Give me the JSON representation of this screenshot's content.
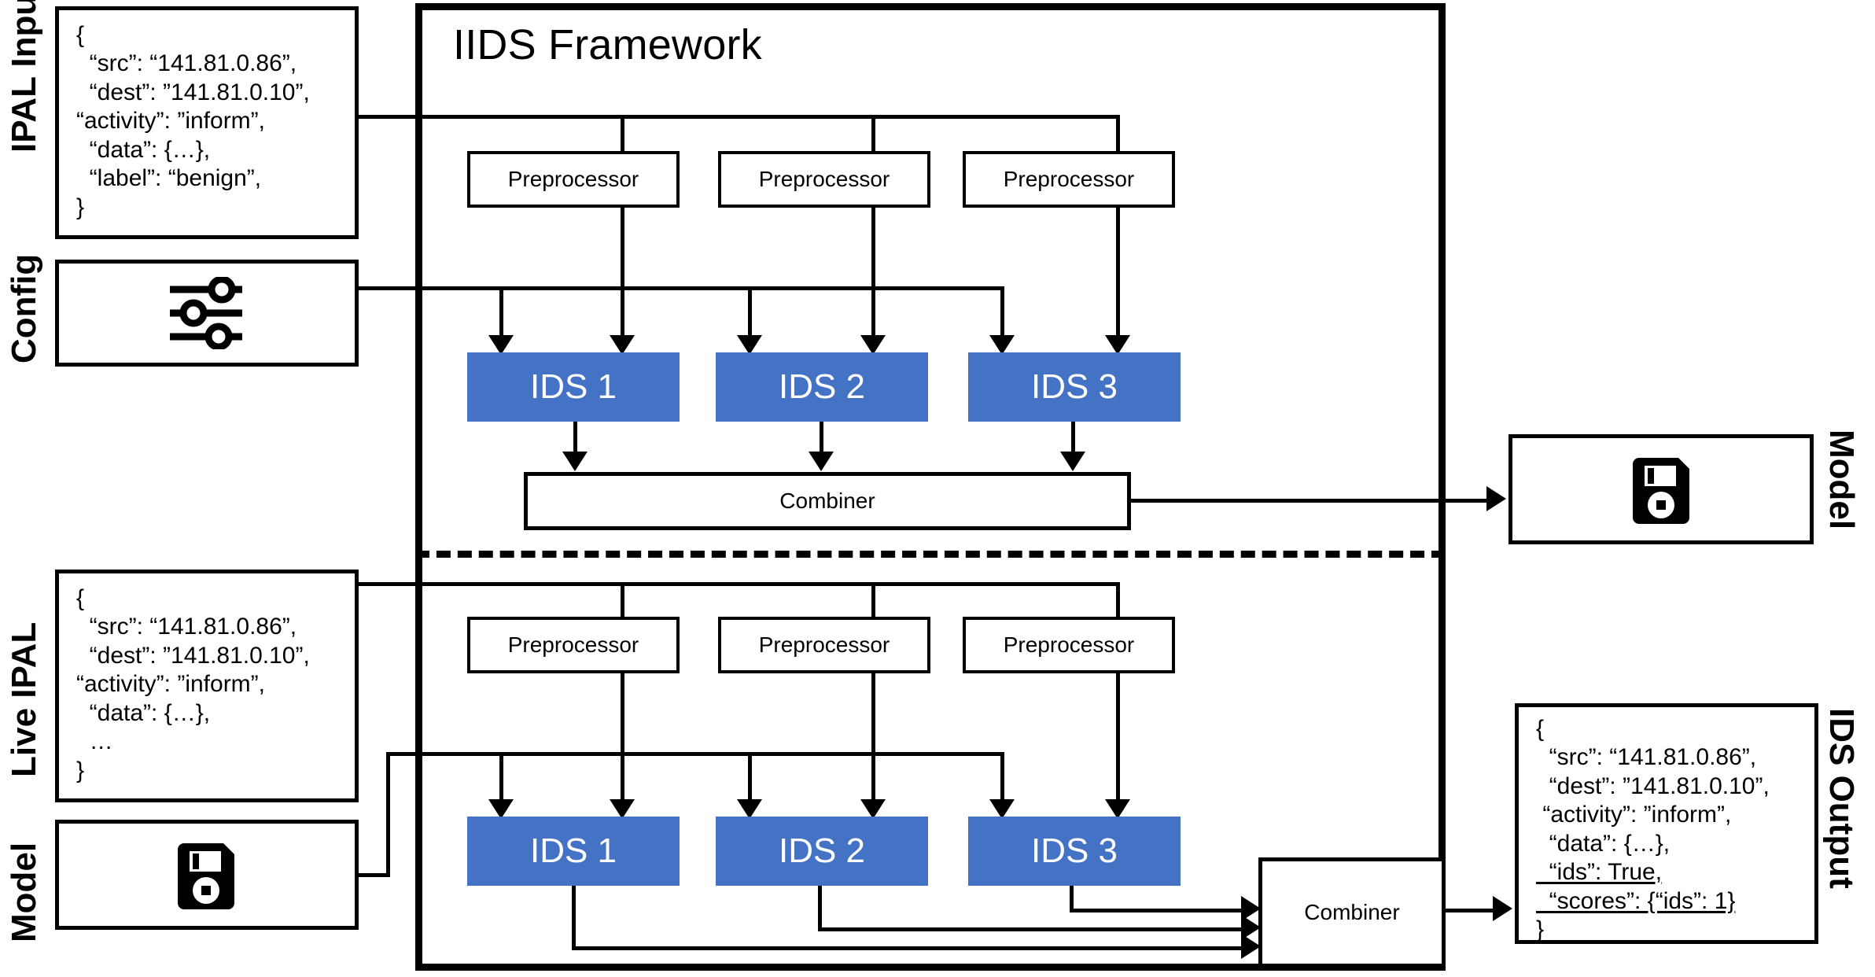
{
  "framework": {
    "title": "IIDS Framework"
  },
  "side_labels": {
    "ipal_input": "IPAL Input",
    "config": "Config",
    "live_ipal": "Live IPAL",
    "model_left": "Model",
    "model_right": "Model",
    "ids_output": "IDS Output"
  },
  "icons": {
    "config": "sliders-icon",
    "model_top": "floppy-disk-save-icon",
    "model_bottom": "floppy-disk-save-icon"
  },
  "ipal_input": {
    "lines": [
      "{",
      "  “src”: “141.81.0.86”,",
      "  “dest”: ”141.81.0.10”,",
      "“activity”: ”inform”,",
      "  “data”: {…},",
      "  “label”: “benign”,",
      "}"
    ]
  },
  "live_ipal": {
    "lines": [
      "{",
      "  “src”: “141.81.0.86”,",
      "  “dest”: ”141.81.0.10”,",
      "“activity”: ”inform”,",
      "  “data”: {…},",
      "  …",
      "}"
    ]
  },
  "ids_output": {
    "lines": [
      {
        "text": "{",
        "underline": false
      },
      {
        "text": "  “src”: “141.81.0.86”,",
        "underline": false
      },
      {
        "text": "  “dest”: ”141.81.0.10”,",
        "underline": false
      },
      {
        "text": " “activity”: ”inform”,",
        "underline": false
      },
      {
        "text": "  “data”: {…},",
        "underline": false
      },
      {
        "text": "  “ids”: True,",
        "underline": true
      },
      {
        "text": "  “scores”: {“ids”: 1}",
        "underline": true
      },
      {
        "text": "}",
        "underline": false
      }
    ]
  },
  "training_stage": {
    "preprocessors": [
      {
        "label": "Preprocessor"
      },
      {
        "label": "Preprocessor"
      },
      {
        "label": "Preprocessor"
      }
    ],
    "ids": [
      {
        "label": "IDS 1"
      },
      {
        "label": "IDS 2"
      },
      {
        "label": "IDS 3"
      }
    ],
    "combiner": {
      "label": "Combiner"
    }
  },
  "live_stage": {
    "preprocessors": [
      {
        "label": "Preprocessor"
      },
      {
        "label": "Preprocessor"
      },
      {
        "label": "Preprocessor"
      }
    ],
    "ids": [
      {
        "label": "IDS 1"
      },
      {
        "label": "IDS 2"
      },
      {
        "label": "IDS 3"
      }
    ],
    "combiner": {
      "label": "Combiner"
    }
  },
  "colors": {
    "ids_fill": "#4472C4",
    "ids_text": "#FFFFFF",
    "line": "#000000",
    "background": "#FFFFFF"
  }
}
